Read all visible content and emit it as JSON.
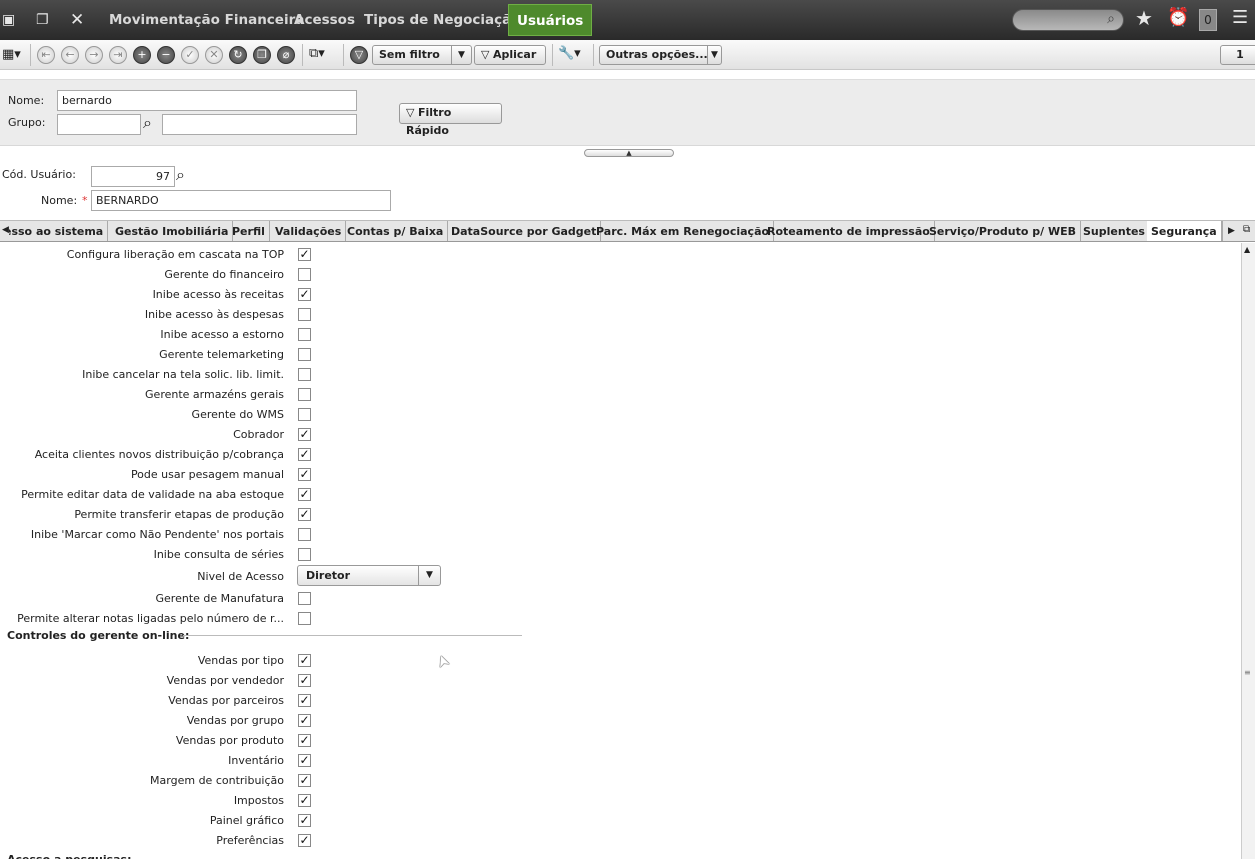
{
  "topbar": {
    "nav": [
      "Movimentação Financeira",
      "Acessos",
      "Tipos de Negociação",
      "Usuários"
    ],
    "active_index": 3,
    "notification_count": "0"
  },
  "toolbar": {
    "filter_label": "Sem filtro",
    "apply_label": "Aplicar",
    "other_options_label": "Outras opções...",
    "page_number": "1"
  },
  "filter": {
    "name_label": "Nome:",
    "name_value": "bernardo",
    "group_label": "Grupo:",
    "group_value": "",
    "group_desc": "",
    "quick_filter_label": "Filtro Rápido"
  },
  "record": {
    "code_label": "Cód. Usuário:",
    "code_value": "97",
    "name_label": "Nome:",
    "required_mark": "*",
    "name_value": "BERNARDO"
  },
  "tabs": [
    "esso ao sistema",
    "Gestão Imobiliária",
    "Perfil",
    "Validações",
    "Contas p/ Baixa",
    "DataSource por Gadget",
    "Parc. Máx em Renegociação",
    "Roteamento de impressão",
    "Serviço/Produto p/ WEB",
    "Suplentes",
    "Segurança"
  ],
  "active_tab": "Segurança",
  "fields": [
    {
      "label": "Configura liberação em cascata na TOP",
      "checked": true
    },
    {
      "label": "Gerente do financeiro",
      "checked": false
    },
    {
      "label": "Inibe acesso às receitas",
      "checked": true
    },
    {
      "label": "Inibe acesso às despesas",
      "checked": false
    },
    {
      "label": "Inibe acesso a estorno",
      "checked": false
    },
    {
      "label": "Gerente telemarketing",
      "checked": false
    },
    {
      "label": "Inibe cancelar na tela solic. lib. limit.",
      "checked": false
    },
    {
      "label": "Gerente armazéns gerais",
      "checked": false
    },
    {
      "label": "Gerente do WMS",
      "checked": false
    },
    {
      "label": "Cobrador",
      "checked": true
    },
    {
      "label": "Aceita clientes novos distribuição p/cobrança",
      "checked": true
    },
    {
      "label": "Pode usar pesagem manual",
      "checked": true
    },
    {
      "label": "Permite editar data de validade na aba estoque",
      "checked": true
    },
    {
      "label": "Permite transferir etapas de produção",
      "checked": true
    },
    {
      "label": "Inibe 'Marcar como Não Pendente' nos portais",
      "checked": false
    },
    {
      "label": "Inibe consulta de séries",
      "checked": false
    }
  ],
  "access_level": {
    "label": "Nivel de Acesso",
    "value": "Diretor"
  },
  "fields2": [
    {
      "label": "Gerente de Manufatura",
      "checked": false
    },
    {
      "label": "Permite alterar notas ligadas pelo número de r...",
      "checked": false
    }
  ],
  "section_online": "Controles do gerente on-line:",
  "online": [
    {
      "label": "Vendas por tipo",
      "checked": true
    },
    {
      "label": "Vendas por vendedor",
      "checked": true
    },
    {
      "label": "Vendas por parceiros",
      "checked": true
    },
    {
      "label": "Vendas por grupo",
      "checked": true
    },
    {
      "label": "Vendas por produto",
      "checked": true
    },
    {
      "label": "Inventário",
      "checked": true
    },
    {
      "label": "Margem de contribuição",
      "checked": true
    },
    {
      "label": "Impostos",
      "checked": true
    },
    {
      "label": "Painel gráfico",
      "checked": true
    },
    {
      "label": "Preferências",
      "checked": true
    }
  ],
  "section_next": "Acesso a pesquisas:"
}
